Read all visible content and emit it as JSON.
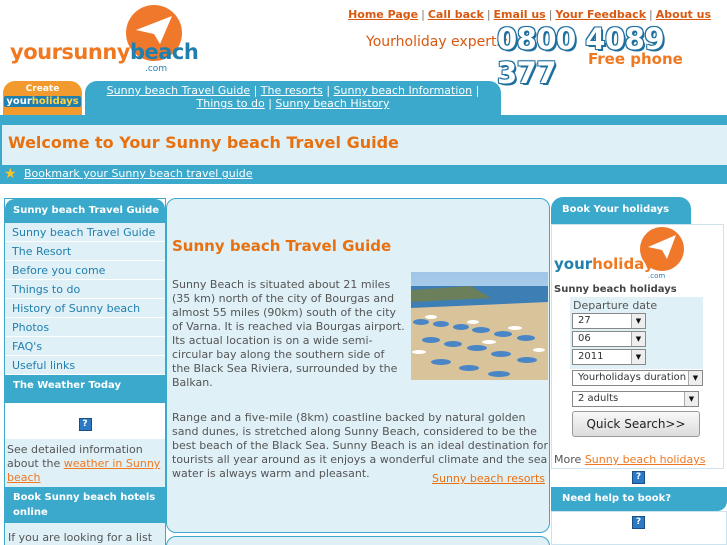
{
  "brand": {
    "name_part1": "yoursunny",
    "name_part2": "beach",
    "suffix": ".com"
  },
  "top_links": [
    "Home Page",
    "Call back",
    "Email us",
    "Your Feedback",
    "About us"
  ],
  "phone": {
    "label": "Yourholiday experts:",
    "number": "0800 4089 377",
    "note": "Free phone"
  },
  "create_tab": {
    "line1": "Create",
    "line2_a": "your",
    "line2_b": "holidays"
  },
  "nav": [
    "Sunny beach Travel Guide",
    "The resorts",
    "Sunny beach Information",
    "Things to do",
    "Sunny beach History"
  ],
  "welcome_title": "Welcome to Your Sunny beach Travel Guide",
  "bookmark_link": "Bookmark your Sunny beach travel guide",
  "left_sidebar": {
    "heading": "Sunny beach Travel Guide",
    "items": [
      "Sunny beach Travel Guide",
      "The Resort",
      "Before you come",
      "Things to do",
      "History of Sunny beach",
      "Photos",
      "FAQ's",
      "Useful links"
    ],
    "weather_heading": "The Weather Today",
    "weather_text": "See detailed information about the ",
    "weather_link": "weather in Sunny beach",
    "hotels_heading": "Book Sunny beach hotels online",
    "hotels_text": "If you are looking for a list of"
  },
  "main": {
    "title": "Sunny beach Travel Guide",
    "para1": "Sunny Beach is situated about 21 miles (35 km) north of the city of Bourgas and almost 55 miles (90km) south of the city of Varna. It is reached via Bourgas airport. Its actual location is on a wide semi-circular bay along the southern side of the Black Sea Riviera, surrounded by the Balkan.",
    "para2": "Range and a five-mile (8km) coastline backed by natural golden sand dunes, is stretched along Sunny Beach, considered to be the best beach of the Black Sea. Sunny Beach is an ideal destination for tourists all year around as it enjoys a wonderful climate and the sea water is always warm and pleasant.",
    "resorts_link": "Sunny beach resorts"
  },
  "right_sidebar": {
    "tab": "Book Your holidays",
    "logo_a": "your",
    "logo_b": "holidays",
    "logo_suffix": ".com",
    "section_label": "Sunny beach holidays",
    "departure_label": "Departure date",
    "day": "27",
    "month": "06",
    "year": "2011",
    "duration": "Yourholidays duration",
    "adults": "2 adults",
    "search_button": "Quick Search>>",
    "more_text": "More ",
    "more_link": "Sunny beach holidays",
    "help_heading": "Need help to book?"
  },
  "colors": {
    "accent_orange": "#e8700f",
    "accent_blue": "#3aa9cc",
    "light_blue": "#dff0f7"
  }
}
